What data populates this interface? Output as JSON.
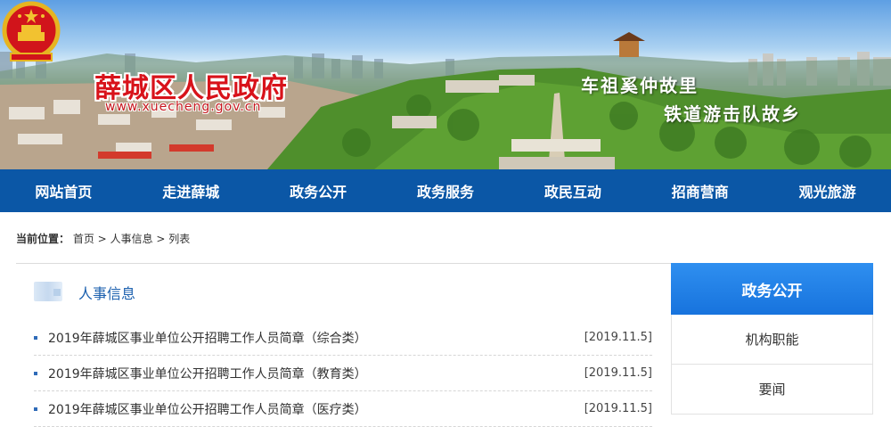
{
  "header": {
    "site_title": "薛城区人民政府",
    "site_url": "www.xuecheng.gov.cn",
    "slogan_line1": "车祖奚仲故里",
    "slogan_line2": "铁道游击队故乡"
  },
  "nav": {
    "items": [
      "网站首页",
      "走进薛城",
      "政务公开",
      "政务服务",
      "政民互动",
      "招商营商",
      "观光旅游"
    ]
  },
  "breadcrumb": {
    "label": "当前位置：",
    "items": [
      "首页",
      "人事信息",
      "列表"
    ],
    "separator": " >"
  },
  "main": {
    "section_title": "人事信息",
    "articles": [
      {
        "title": "2019年薛城区事业单位公开招聘工作人员简章（综合类）",
        "date": "[2019.11.5]"
      },
      {
        "title": "2019年薛城区事业单位公开招聘工作人员简章（教育类）",
        "date": "[2019.11.5]"
      },
      {
        "title": "2019年薛城区事业单位公开招聘工作人员简章（医疗类）",
        "date": "[2019.11.5]"
      }
    ]
  },
  "sidebar": {
    "title": "政务公开",
    "items": [
      "机构职能",
      "要闻"
    ]
  },
  "colors": {
    "nav_bg": "#0b57a6",
    "title_red": "#d8121a",
    "accent_blue": "#1a5fae",
    "sidebar_head": "#1773dd"
  }
}
